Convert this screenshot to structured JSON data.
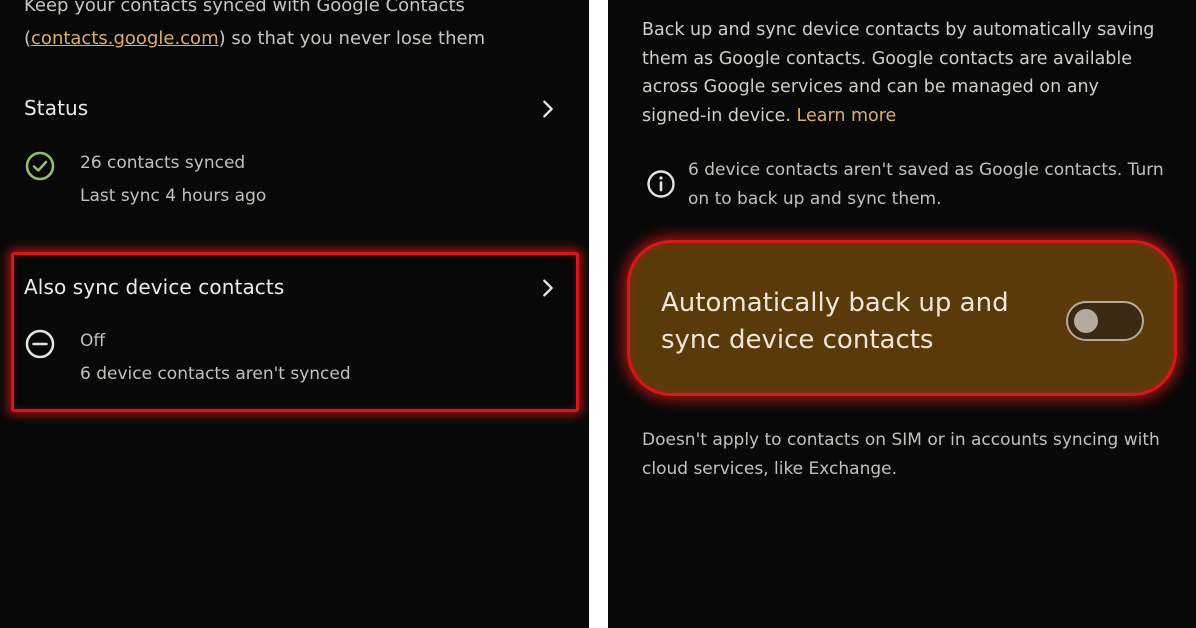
{
  "left": {
    "intro": {
      "line1": "Keep your contacts synced with Google Contacts",
      "open_paren": "(",
      "link": "contacts.google.com",
      "rest": ") so that you never lose them"
    },
    "status": {
      "title": "Status",
      "line1": "26 contacts synced",
      "line2": "Last sync 4 hours ago"
    },
    "device_sync": {
      "title": "Also sync device contacts",
      "line1": "Off",
      "line2": "6 device contacts aren't synced"
    }
  },
  "right": {
    "description": "Back up and sync device contacts by automatically saving them as Google contacts. Google contacts are available across Google services and can be managed on any signed-in device.",
    "learn_more": "Learn more",
    "info": "6 device contacts aren't saved as Google contacts. Turn on to back up and sync them.",
    "toggle": {
      "label": "Automatically back up and sync device contacts",
      "state": "off"
    },
    "footnote": "Doesn't apply to contacts on SIM or in accounts syncing with cloud services, like Exchange."
  },
  "colors": {
    "background": "#080808",
    "highlight": "#d6181a",
    "accent_link": "#d9b06a",
    "card": "#5a3a0a",
    "status_green": "#8fc36a"
  }
}
